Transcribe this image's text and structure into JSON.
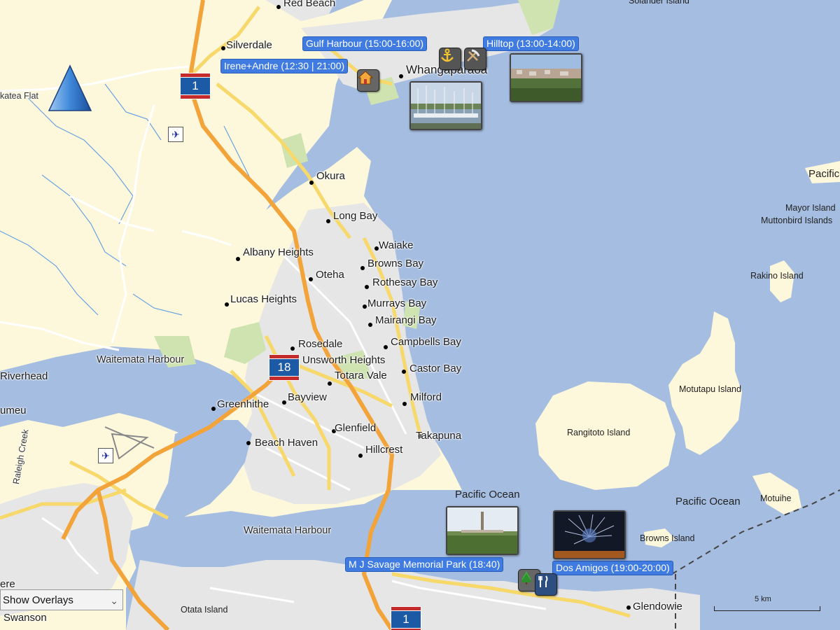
{
  "map": {
    "towns": {
      "red_beach": "Red Beach",
      "silverdale": "Silverdale",
      "katea_flat": "katea Flat",
      "whangaparaoa": "Whangaparaoa",
      "okura": "Okura",
      "long_bay": "Long Bay",
      "waiake": "Waiake",
      "browns_bay": "Browns Bay",
      "albany_heights": "Albany Heights",
      "oteha": "Oteha",
      "rothesay_bay": "Rothesay Bay",
      "lucas_heights": "Lucas Heights",
      "murrays_bay": "Murrays Bay",
      "mairangi_bay": "Mairangi Bay",
      "campbells_bay": "Campbells Bay",
      "rosedale": "Rosedale",
      "unsworth_heights": "Unsworth Heights",
      "castor_bay": "Castor Bay",
      "totara_vale": "Totara Vale",
      "milford": "Milford",
      "bayview": "Bayview",
      "greenhithe": "Greenhithe",
      "glenfield": "Glenfield",
      "takapuna": "Takapuna",
      "beach_haven": "Beach Haven",
      "hillcrest": "Hillcrest",
      "glendowie": "Glendowie",
      "swanson": "Swanson",
      "riverhead": "Riverhead",
      "kumeu": "umeu",
      "ere": "ere"
    },
    "water": {
      "waitemata_1": "Waitemata Harbour",
      "waitemata_2": "Waitemata Harbour",
      "pacific_1": "Pacific Ocean",
      "pacific_2": "Pacific Ocean",
      "pacific_3": "Pacific"
    },
    "islands": {
      "rangitoto": "Rangitoto Island",
      "motutapu": "Motutapu Island",
      "rakino": "Rakino Island",
      "mayor": "Mayor Island",
      "muttonbird": "Muttonbird Islands",
      "motuihe": "Motuihe",
      "browns_island": "Browns Island",
      "otata": "Otata Island",
      "solander": "Solander Island"
    },
    "roads": {
      "raleigh_creek": "Raleigh Creek",
      "sh1_top": "1",
      "sh18": "18",
      "sh1_bottom": "1"
    },
    "scale_label": "5 km"
  },
  "pois": {
    "gulf_harbour": "Gulf Harbour (15:00-16:00)",
    "irene_andre": "Irene+Andre (12:30 | 21:00)",
    "hilltop": "Hilltop (13:00-14:00)",
    "mj_savage": "M J Savage Memorial Park (18:40)",
    "dos_amigos": "Dos Amigos (19:00-20:00)"
  },
  "icons": [
    "home-icon",
    "anchor-icon",
    "pickaxe-icon",
    "tree-icon",
    "restaurant-icon",
    "airport-icon",
    "navigation-arrow-icon",
    "chevron-down-icon"
  ],
  "controls": {
    "overlay_select": "Show Overlays"
  },
  "colors": {
    "water": "#a5bde0",
    "land": "#fdf8dc",
    "urban": "#e6e6e6",
    "park": "#cfe3b1",
    "motorway": "#f2a43b",
    "major_road": "#f7d86b",
    "poi_label_bg": "#3f7be0"
  }
}
